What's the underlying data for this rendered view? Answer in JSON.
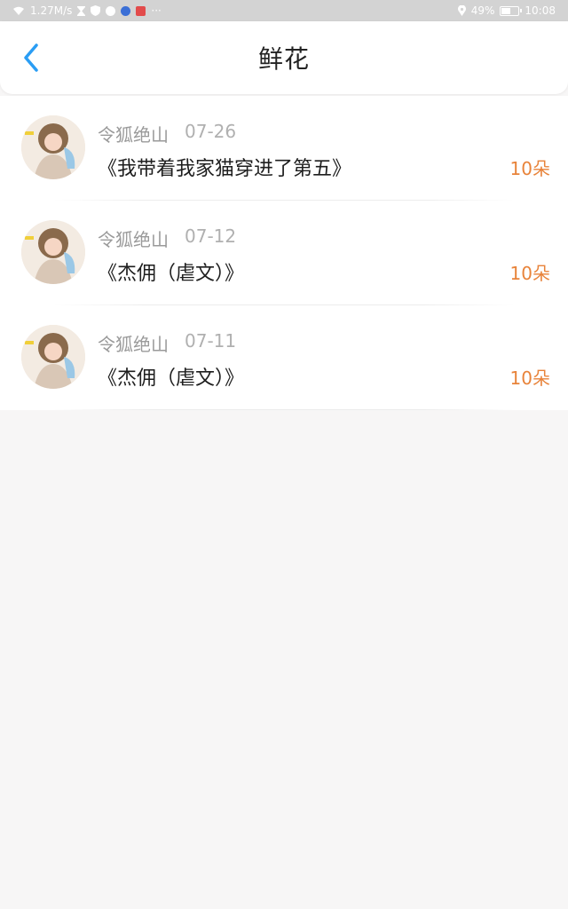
{
  "status_bar": {
    "network_speed": "1.27M/s",
    "overflow": "···",
    "battery": "49%",
    "battery_level": 0.49,
    "time": "10:08"
  },
  "header": {
    "title": "鲜花"
  },
  "colors": {
    "accent_blue": "#2a9df4",
    "count_orange": "#e8833a"
  },
  "flowers": [
    {
      "user": "令狐绝山",
      "date": "07-26",
      "book": "《我带着我家猫穿进了第五》",
      "amount": "10朵"
    },
    {
      "user": "令狐绝山",
      "date": "07-12",
      "book": "《杰佣（虐文）》",
      "amount": "10朵"
    },
    {
      "user": "令狐绝山",
      "date": "07-11",
      "book": "《杰佣（虐文）》",
      "amount": "10朵"
    }
  ]
}
